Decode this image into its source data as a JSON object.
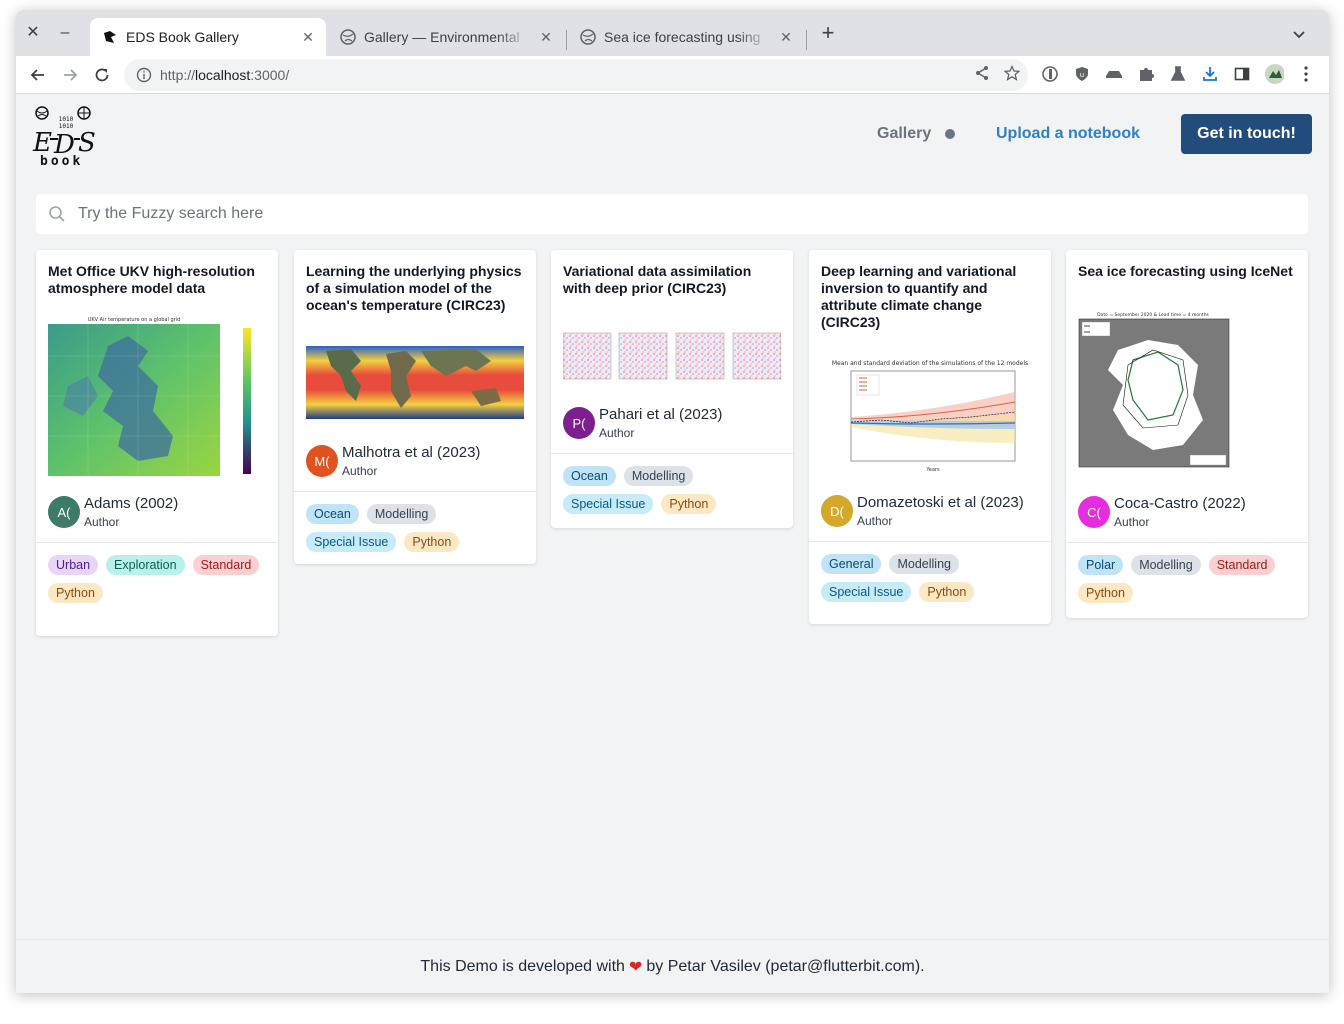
{
  "browser": {
    "tabs": [
      {
        "title": "EDS Book Gallery",
        "active": true
      },
      {
        "title": "Gallery — Environmental",
        "active": false
      },
      {
        "title": "Sea ice forecasting using",
        "active": false
      }
    ],
    "url_prefix": "http://",
    "url_host": "localhost",
    "url_rest": ":3000/"
  },
  "header": {
    "logo_text": "EDS book",
    "nav_gallery": "Gallery",
    "nav_upload": "Upload a notebook",
    "cta": "Get in touch!"
  },
  "search": {
    "placeholder": "Try the Fuzzy search here"
  },
  "cards": [
    {
      "title": "Met Office UKV high-resolution atmosphere model data",
      "thumb_caption": "UKV Air temperature on a global grid",
      "avatar_initials": "A(",
      "avatar_color": "#3d7a6a",
      "author": "Adams (2002)",
      "role": "Author",
      "tags": [
        "Urban",
        "Exploration",
        "Standard",
        "Python"
      ]
    },
    {
      "title": "Learning the underlying physics of a simulation model of the ocean's temperature (CIRC23)",
      "avatar_initials": "M(",
      "avatar_color": "#e0531f",
      "author": "Malhotra et al (2023)",
      "role": "Author",
      "tags": [
        "Ocean",
        "Modelling",
        "Special Issue",
        "Python"
      ]
    },
    {
      "title": "Variational data assimilation with deep prior (CIRC23)",
      "avatar_initials": "P(",
      "avatar_color": "#7e1f8f",
      "author": "Pahari et al (2023)",
      "role": "Author",
      "tags": [
        "Ocean",
        "Modelling",
        "Special Issue",
        "Python"
      ]
    },
    {
      "title": "Deep learning and variational inversion to quantify and attribute climate change (CIRC23)",
      "thumb_caption": "Mean and standard deviation of the simulations of the 12 models",
      "avatar_initials": "D(",
      "avatar_color": "#d4a82a",
      "author": "Domazetoski et al (2023)",
      "role": "Author",
      "tags": [
        "General",
        "Modelling",
        "Special Issue",
        "Python"
      ]
    },
    {
      "title": "Sea ice forecasting using IceNet",
      "thumb_caption": "Date = September 2020 & Lead time = 4 months",
      "avatar_initials": "C(",
      "avatar_color": "#e62ee0",
      "author": "Coca-Castro (2022)",
      "role": "Author",
      "tags": [
        "Polar",
        "Modelling",
        "Standard",
        "Python"
      ]
    }
  ],
  "footer": {
    "before": "This Demo is developed with",
    "after": "by Petar Vasilev (petar@flutterbit.com)."
  },
  "colors": {
    "cta_bg": "#214c7c",
    "link": "#2f80c4"
  }
}
